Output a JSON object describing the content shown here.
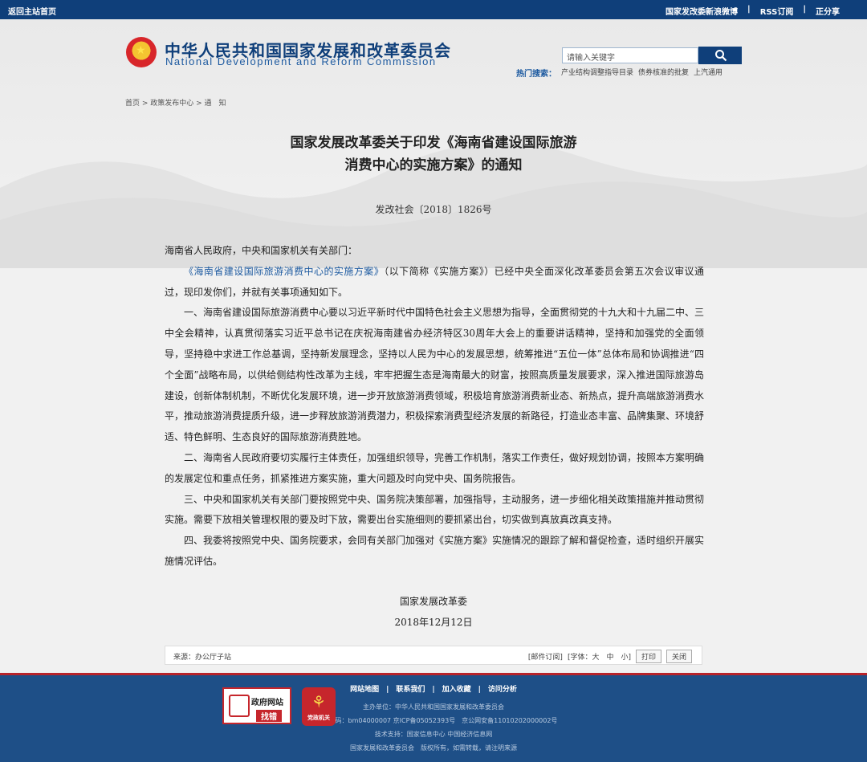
{
  "topbar": {
    "home": "返回主站首页",
    "links": [
      "国家发改委新浪微博",
      "RSS订阅",
      "正分享"
    ]
  },
  "header": {
    "title_cn": "中华人民共和国国家发展和改革委员会",
    "title_en": "National Development and Reform Commission"
  },
  "search": {
    "placeholder": "请输入关键字",
    "hot_label": "热门搜索：",
    "hot_items": [
      "产业结构调整指导目录",
      "债券核准的批复",
      "上汽通用"
    ]
  },
  "breadcrumb": "首页 > 政策发布中心 > 通　知",
  "document": {
    "title_line1": "国家发展改革委关于印发《海南省建设国际旅游",
    "title_line2": "消费中心的实施方案》的通知",
    "number": "发改社会〔2018〕1826号",
    "addressee": "海南省人民政府，中央和国家机关有关部门：",
    "link_text": "《海南省建设国际旅游消费中心的实施方案》",
    "p1_rest": "（以下简称《实施方案》）已经中央全面深化改革委员会第五次会议审议通过，现印发你们，并就有关事项通知如下。",
    "p2": "一、海南省建设国际旅游消费中心要以习近平新时代中国特色社会主义思想为指导，全面贯彻党的十九大和十九届二中、三中全会精神，认真贯彻落实习近平总书记在庆祝海南建省办经济特区30周年大会上的重要讲话精神，坚持和加强党的全面领导，坚持稳中求进工作总基调，坚持新发展理念，坚持以人民为中心的发展思想，统筹推进“五位一体”总体布局和协调推进“四个全面”战略布局，以供给侧结构性改革为主线，牢牢把握生态是海南最大的财富，按照高质量发展要求，深入推进国际旅游岛建设，创新体制机制，不断优化发展环境，进一步开放旅游消费领域，积极培育旅游消费新业态、新热点，提升高端旅游消费水平，推动旅游消费提质升级，进一步释放旅游消费潜力，积极探索消费型经济发展的新路径，打造业态丰富、品牌集聚、环境舒适、特色鲜明、生态良好的国际旅游消费胜地。",
    "p3": "二、海南省人民政府要切实履行主体责任，加强组织领导，完善工作机制，落实工作责任，做好规划协调，按照本方案明确的发展定位和重点任务，抓紧推进方案实施，重大问题及时向党中央、国务院报告。",
    "p4": "三、中央和国家机关有关部门要按照党中央、国务院决策部署，加强指导，主动服务，进一步细化相关政策措施并推动贯彻实施。需要下放相关管理权限的要及时下放，需要出台实施细则的要抓紧出台，切实做到真放真改真支持。",
    "p5": "四、我委将按照党中央、国务院要求，会同有关部门加强对《实施方案》实施情况的跟踪了解和督促检查，适时组织开展实施情况评估。",
    "signer": "国家发展改革委",
    "date": "2018年12月12日"
  },
  "toolbar": {
    "source": "来源：办公厅子站",
    "subscribe": "[邮件订阅]",
    "font": "[字体：大　中　小]",
    "print": "打印",
    "close": "关闭"
  },
  "footer": {
    "links": "网站地图　|　联系我们　|　加入收藏　|　访问分析",
    "host": "主办单位：中华人民共和国国家发展和改革委员会",
    "icp": "网站标识码：bm04000007 京ICP备05052393号　京公网安备11010202000002号",
    "tech": "技术支持：国家信息中心  中国经济信息网",
    "copyright": "国家发展和改革委员会　版权所有，如需转载，请注明来源",
    "badge1_line1": "政府网站",
    "badge1_line2": "找错",
    "badge2_text": "党政机关"
  }
}
